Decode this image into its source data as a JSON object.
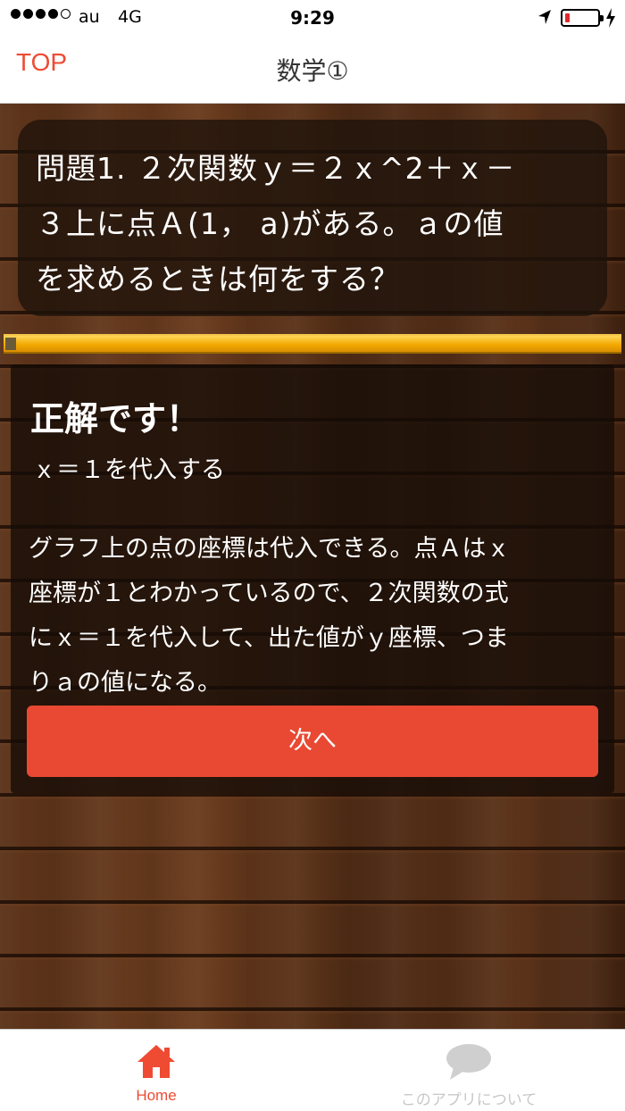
{
  "status_bar": {
    "carrier": "au",
    "network": "4G",
    "time": "9:29",
    "signal_bars_filled": 4,
    "signal_bars_total": 5,
    "battery_level": 0.1
  },
  "nav": {
    "back_label": "TOP",
    "title": "数学①"
  },
  "question": {
    "text_line1": "問題1. ２次関数ｙ＝２ｘ^2＋ｘ－",
    "text_line2": "３上に点Ａ(1，  a)がある。ａの値",
    "text_line3": "を求めるときは何をする？"
  },
  "progress": {
    "value": 1.0
  },
  "result": {
    "title": "正解です！",
    "answer": "ｘ＝１を代入する",
    "explain_line1": "グラフ上の点の座標は代入できる。点Ａはｘ",
    "explain_line2": "座標が１とわかっているので、２次関数の式",
    "explain_line3": "にｘ＝１を代入して、出た値がｙ座標、つま",
    "explain_line4": "りａの値になる。",
    "next_label": "次へ"
  },
  "tabbar": {
    "tabs": [
      {
        "label": "Home",
        "icon": "home-icon",
        "active": true
      },
      {
        "label": "このアプリについて",
        "icon": "speech-bubble-icon",
        "active": false
      }
    ]
  },
  "colors": {
    "accent": "#ee4b32",
    "button": "#e94832",
    "progress": "#f2a900"
  }
}
